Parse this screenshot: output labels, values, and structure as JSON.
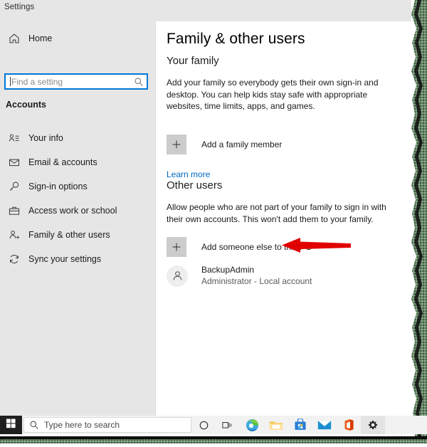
{
  "window": {
    "title": "Settings"
  },
  "sidebar": {
    "home_label": "Home",
    "home_icon": "home-icon",
    "search": {
      "placeholder": "Find a setting",
      "value": "",
      "icon": "search-icon"
    },
    "section_header": "Accounts",
    "items": [
      {
        "label": "Your info",
        "icon": "user-info-icon"
      },
      {
        "label": "Email & accounts",
        "icon": "envelope-icon"
      },
      {
        "label": "Sign-in options",
        "icon": "key-icon"
      },
      {
        "label": "Access work or school",
        "icon": "briefcase-icon"
      },
      {
        "label": "Family & other users",
        "icon": "user-add-icon"
      },
      {
        "label": "Sync your settings",
        "icon": "sync-icon"
      }
    ]
  },
  "main": {
    "page_title": "Family & other users",
    "your_family": {
      "heading": "Your family",
      "description": "Add your family so everybody gets their own sign-in and desktop. You can help kids stay safe with appropriate websites, time limits, apps, and games.",
      "add_button_label": "Add a family member",
      "add_button_icon": "plus-icon",
      "learn_more_label": "Learn more"
    },
    "other_users": {
      "heading": "Other users",
      "description": "Allow people who are not part of your family to sign in with their own accounts. This won't add them to your family.",
      "add_button_label": "Add someone else to this PC",
      "add_button_icon": "plus-icon",
      "account": {
        "name": "BackupAdmin",
        "description": "Administrator - Local account",
        "avatar_icon": "person-avatar-icon"
      }
    }
  },
  "annotation": {
    "arrow_color": "#e00000",
    "arrow_direction": "left",
    "points_at": "Add someone else to this PC"
  },
  "taskbar": {
    "start_icon": "windows-logo-icon",
    "search": {
      "label": "Type here to search",
      "icon": "search-icon"
    },
    "items": [
      {
        "name": "cortana-icon",
        "label": "Cortana"
      },
      {
        "name": "task-view-icon",
        "label": "Task View"
      },
      {
        "name": "edge-icon",
        "label": "Microsoft Edge"
      },
      {
        "name": "file-explorer-icon",
        "label": "File Explorer"
      },
      {
        "name": "microsoft-store-icon",
        "label": "Microsoft Store"
      },
      {
        "name": "mail-icon",
        "label": "Mail"
      },
      {
        "name": "office-icon",
        "label": "Office"
      },
      {
        "name": "settings-gear-icon",
        "label": "Settings"
      }
    ]
  },
  "colors": {
    "accent_blue": "#0078d7",
    "link_blue": "#0067c0",
    "sidebar_bg": "#e6e6e6",
    "annotation_red": "#e00000"
  }
}
